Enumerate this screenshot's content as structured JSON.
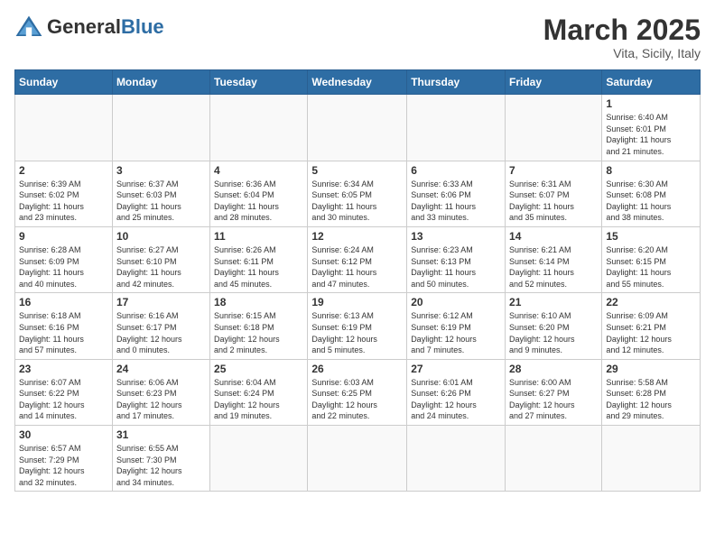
{
  "header": {
    "logo_general": "General",
    "logo_blue": "Blue",
    "month": "March 2025",
    "location": "Vita, Sicily, Italy"
  },
  "weekdays": [
    "Sunday",
    "Monday",
    "Tuesday",
    "Wednesday",
    "Thursday",
    "Friday",
    "Saturday"
  ],
  "weeks": [
    [
      {
        "day": "",
        "info": ""
      },
      {
        "day": "",
        "info": ""
      },
      {
        "day": "",
        "info": ""
      },
      {
        "day": "",
        "info": ""
      },
      {
        "day": "",
        "info": ""
      },
      {
        "day": "",
        "info": ""
      },
      {
        "day": "1",
        "info": "Sunrise: 6:40 AM\nSunset: 6:01 PM\nDaylight: 11 hours\nand 21 minutes."
      }
    ],
    [
      {
        "day": "2",
        "info": "Sunrise: 6:39 AM\nSunset: 6:02 PM\nDaylight: 11 hours\nand 23 minutes."
      },
      {
        "day": "3",
        "info": "Sunrise: 6:37 AM\nSunset: 6:03 PM\nDaylight: 11 hours\nand 25 minutes."
      },
      {
        "day": "4",
        "info": "Sunrise: 6:36 AM\nSunset: 6:04 PM\nDaylight: 11 hours\nand 28 minutes."
      },
      {
        "day": "5",
        "info": "Sunrise: 6:34 AM\nSunset: 6:05 PM\nDaylight: 11 hours\nand 30 minutes."
      },
      {
        "day": "6",
        "info": "Sunrise: 6:33 AM\nSunset: 6:06 PM\nDaylight: 11 hours\nand 33 minutes."
      },
      {
        "day": "7",
        "info": "Sunrise: 6:31 AM\nSunset: 6:07 PM\nDaylight: 11 hours\nand 35 minutes."
      },
      {
        "day": "8",
        "info": "Sunrise: 6:30 AM\nSunset: 6:08 PM\nDaylight: 11 hours\nand 38 minutes."
      }
    ],
    [
      {
        "day": "9",
        "info": "Sunrise: 6:28 AM\nSunset: 6:09 PM\nDaylight: 11 hours\nand 40 minutes."
      },
      {
        "day": "10",
        "info": "Sunrise: 6:27 AM\nSunset: 6:10 PM\nDaylight: 11 hours\nand 42 minutes."
      },
      {
        "day": "11",
        "info": "Sunrise: 6:26 AM\nSunset: 6:11 PM\nDaylight: 11 hours\nand 45 minutes."
      },
      {
        "day": "12",
        "info": "Sunrise: 6:24 AM\nSunset: 6:12 PM\nDaylight: 11 hours\nand 47 minutes."
      },
      {
        "day": "13",
        "info": "Sunrise: 6:23 AM\nSunset: 6:13 PM\nDaylight: 11 hours\nand 50 minutes."
      },
      {
        "day": "14",
        "info": "Sunrise: 6:21 AM\nSunset: 6:14 PM\nDaylight: 11 hours\nand 52 minutes."
      },
      {
        "day": "15",
        "info": "Sunrise: 6:20 AM\nSunset: 6:15 PM\nDaylight: 11 hours\nand 55 minutes."
      }
    ],
    [
      {
        "day": "16",
        "info": "Sunrise: 6:18 AM\nSunset: 6:16 PM\nDaylight: 11 hours\nand 57 minutes."
      },
      {
        "day": "17",
        "info": "Sunrise: 6:16 AM\nSunset: 6:17 PM\nDaylight: 12 hours\nand 0 minutes."
      },
      {
        "day": "18",
        "info": "Sunrise: 6:15 AM\nSunset: 6:18 PM\nDaylight: 12 hours\nand 2 minutes."
      },
      {
        "day": "19",
        "info": "Sunrise: 6:13 AM\nSunset: 6:19 PM\nDaylight: 12 hours\nand 5 minutes."
      },
      {
        "day": "20",
        "info": "Sunrise: 6:12 AM\nSunset: 6:19 PM\nDaylight: 12 hours\nand 7 minutes."
      },
      {
        "day": "21",
        "info": "Sunrise: 6:10 AM\nSunset: 6:20 PM\nDaylight: 12 hours\nand 9 minutes."
      },
      {
        "day": "22",
        "info": "Sunrise: 6:09 AM\nSunset: 6:21 PM\nDaylight: 12 hours\nand 12 minutes."
      }
    ],
    [
      {
        "day": "23",
        "info": "Sunrise: 6:07 AM\nSunset: 6:22 PM\nDaylight: 12 hours\nand 14 minutes."
      },
      {
        "day": "24",
        "info": "Sunrise: 6:06 AM\nSunset: 6:23 PM\nDaylight: 12 hours\nand 17 minutes."
      },
      {
        "day": "25",
        "info": "Sunrise: 6:04 AM\nSunset: 6:24 PM\nDaylight: 12 hours\nand 19 minutes."
      },
      {
        "day": "26",
        "info": "Sunrise: 6:03 AM\nSunset: 6:25 PM\nDaylight: 12 hours\nand 22 minutes."
      },
      {
        "day": "27",
        "info": "Sunrise: 6:01 AM\nSunset: 6:26 PM\nDaylight: 12 hours\nand 24 minutes."
      },
      {
        "day": "28",
        "info": "Sunrise: 6:00 AM\nSunset: 6:27 PM\nDaylight: 12 hours\nand 27 minutes."
      },
      {
        "day": "29",
        "info": "Sunrise: 5:58 AM\nSunset: 6:28 PM\nDaylight: 12 hours\nand 29 minutes."
      }
    ],
    [
      {
        "day": "30",
        "info": "Sunrise: 6:57 AM\nSunset: 7:29 PM\nDaylight: 12 hours\nand 32 minutes."
      },
      {
        "day": "31",
        "info": "Sunrise: 6:55 AM\nSunset: 7:30 PM\nDaylight: 12 hours\nand 34 minutes."
      },
      {
        "day": "",
        "info": ""
      },
      {
        "day": "",
        "info": ""
      },
      {
        "day": "",
        "info": ""
      },
      {
        "day": "",
        "info": ""
      },
      {
        "day": "",
        "info": ""
      }
    ]
  ]
}
